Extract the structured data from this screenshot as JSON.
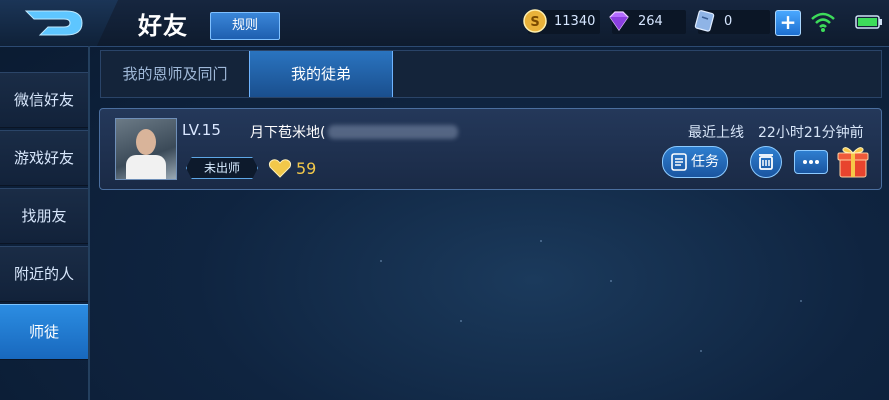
{
  "header": {
    "title": "好友",
    "rules_label": "规则",
    "gold": "11340",
    "diamonds": "264",
    "vouchers": "0",
    "add_label": "+"
  },
  "sidebar": {
    "items": [
      {
        "label": "微信好友",
        "active": false
      },
      {
        "label": "游戏好友",
        "active": false
      },
      {
        "label": "找朋友",
        "active": false
      },
      {
        "label": "附近的人",
        "active": false
      },
      {
        "label": "师徒",
        "active": true
      }
    ]
  },
  "tabs": [
    {
      "label": "我的恩师及同门",
      "active": false
    },
    {
      "label": "我的徒弟",
      "active": true
    }
  ],
  "friend": {
    "level": "LV.15",
    "name": "月下苞米地(",
    "status": "未出师",
    "intimacy": "59",
    "last_online_label": "最近上线",
    "last_online_value": "22小时21分钟前",
    "task_label": "任务"
  },
  "colors": {
    "accent": "#2c8de2",
    "heart": "#f2c84a",
    "wifi": "#3ddc5a",
    "battery": "#3ddc5a"
  }
}
